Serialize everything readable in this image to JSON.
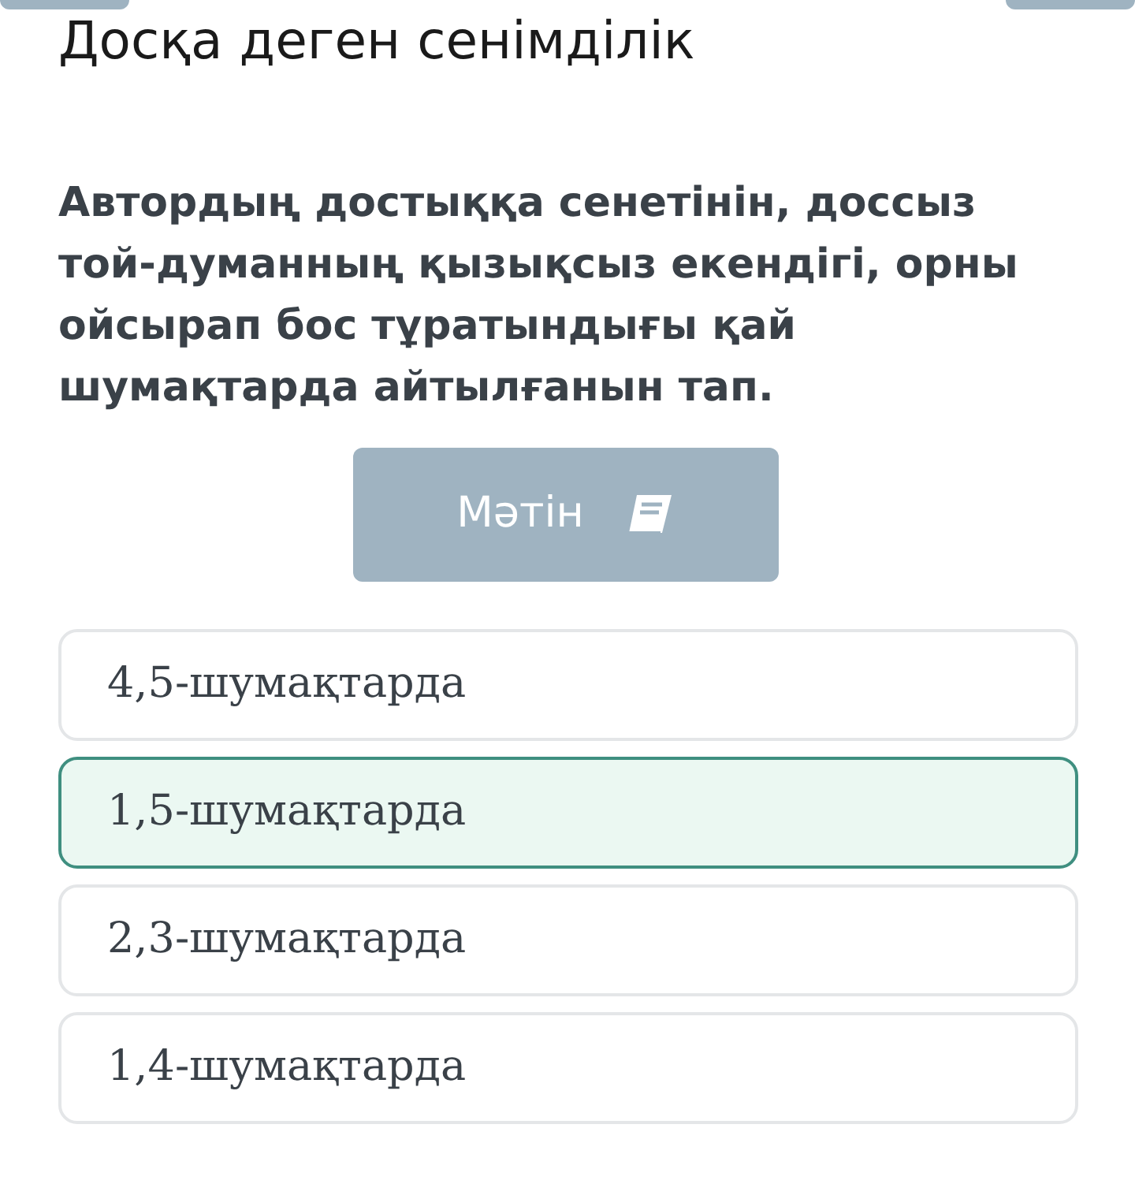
{
  "title": "Досқа деген сенімділік",
  "question": "Автордың достыққа сенетінін, доссыз той-думанның қызықсыз екендігі, орны ойсырап бос тұратындығы қай шумақтарда айтылғанын тап.",
  "text_button": {
    "label": "Мәтін"
  },
  "options": [
    {
      "label": "4,5-шумақтарда",
      "selected": false
    },
    {
      "label": "1,5-шумақтарда",
      "selected": true
    },
    {
      "label": "2,3-шумақтарда",
      "selected": false
    },
    {
      "label": "1,4-шумақтарда",
      "selected": false
    }
  ]
}
